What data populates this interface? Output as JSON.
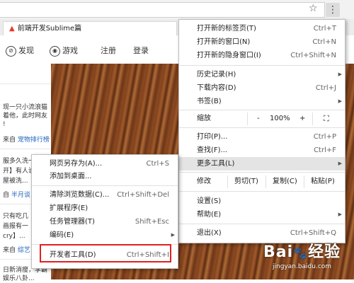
{
  "browser": {
    "star_icon": "star-icon",
    "menu_icon": "kebab-menu-icon",
    "star_glyph": "☆",
    "menu_glyph": "⋮"
  },
  "tab": {
    "title": "前端开发Sublime篇",
    "favicon_glyph": "▲"
  },
  "nav": {
    "discover": "发现",
    "game": "游戏",
    "register": "注册",
    "login": "登录"
  },
  "feed": [
    "现一只小流浪猫",
    "着他，此时网友",
    "!",
    "来自",
    "宠物排行榜",
    "服多久洗一",
    "开】有人说",
    "屋被洗...",
    "自",
    "半月谈",
    "只有吃几",
    "画报有一",
    "cry】...",
    "来自",
    "综艺",
    "日新消瘦，李霸",
    "娱乐八卦..."
  ],
  "main_menu": [
    {
      "label": "打开新的标签页(T)",
      "shortcut": "Ctrl+T"
    },
    {
      "label": "打开新的窗口(N)",
      "shortcut": "Ctrl+N"
    },
    {
      "label": "打开新的隐身窗口(I)",
      "shortcut": "Ctrl+Shift+N"
    },
    {
      "label": "历史记录(H)",
      "shortcut": ""
    },
    {
      "label": "下载内容(D)",
      "shortcut": "Ctrl+J"
    },
    {
      "label": "书签(B)",
      "shortcut": ""
    },
    {
      "label": "打印(P)...",
      "shortcut": "Ctrl+P"
    },
    {
      "label": "查找(F)...",
      "shortcut": "Ctrl+F"
    },
    {
      "label": "更多工具(L)",
      "shortcut": ""
    },
    {
      "label": "设置(S)",
      "shortcut": ""
    },
    {
      "label": "帮助(E)",
      "shortcut": ""
    },
    {
      "label": "退出(X)",
      "shortcut": "Ctrl+Shift+Q"
    }
  ],
  "zoom": {
    "label": "缩放",
    "minus": "-",
    "value": "100%",
    "plus": "+",
    "fullscreen": "⛶"
  },
  "edit": {
    "label": "修改",
    "cut": "剪切(T)",
    "copy": "复制(C)",
    "paste": "粘贴(P)"
  },
  "sub_menu": [
    {
      "label": "网页另存为(A)...",
      "shortcut": "Ctrl+S"
    },
    {
      "label": "添加到桌面...",
      "shortcut": ""
    },
    {
      "label": "清除浏览数据(C)...",
      "shortcut": "Ctrl+Shift+Del"
    },
    {
      "label": "扩展程序(E)",
      "shortcut": ""
    },
    {
      "label": "任务管理器(T)",
      "shortcut": "Shift+Esc"
    },
    {
      "label": "编码(E)",
      "shortcut": ""
    },
    {
      "label": "开发者工具(D)",
      "shortcut": "Ctrl+Shift+I"
    }
  ],
  "watermark": {
    "brand": "Bai",
    "paw": "🐾",
    "brand2": "经验",
    "url": "jingyan.baidu.com"
  },
  "colors": {
    "highlight_box": "#e02020",
    "link": "#2266bb"
  }
}
